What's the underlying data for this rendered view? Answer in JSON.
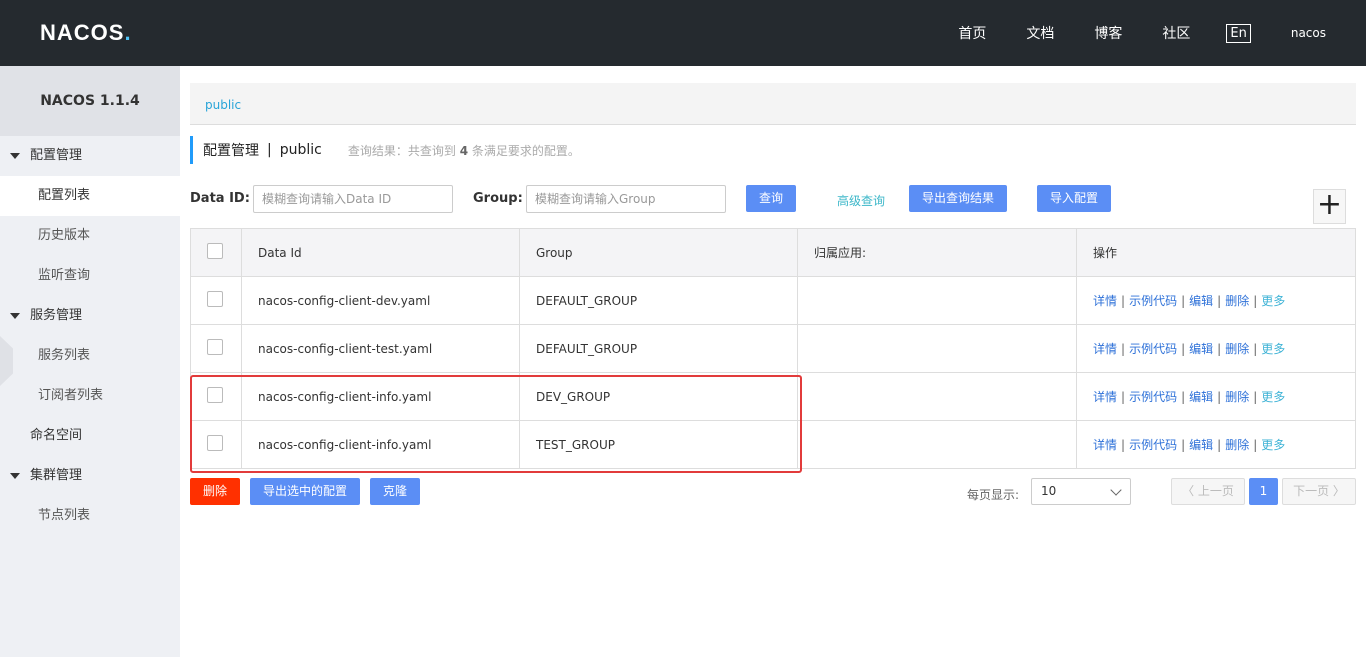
{
  "header": {
    "logo": "NACOS",
    "logo_dot": ".",
    "nav": [
      "首页",
      "文档",
      "博客",
      "社区"
    ],
    "lang": "En",
    "user": "nacos"
  },
  "sidebar": {
    "version": "NACOS 1.1.4",
    "groups": [
      {
        "label": "配置管理",
        "items": [
          "配置列表",
          "历史版本",
          "监听查询"
        ]
      },
      {
        "label": "服务管理",
        "items": [
          "服务列表",
          "订阅者列表"
        ]
      },
      {
        "label": "命名空间"
      },
      {
        "label": "集群管理",
        "items": [
          "节点列表"
        ]
      }
    ]
  },
  "namespace": {
    "current": "public"
  },
  "title": {
    "main": "配置管理",
    "sep": "|",
    "ns": "public",
    "result_prefix": "查询结果：共查询到",
    "result_count": "4",
    "result_suffix": "条满足要求的配置。"
  },
  "search": {
    "dataid_label": "Data ID:",
    "dataid_placeholder": "模糊查询请输入Data ID",
    "group_label": "Group:",
    "group_placeholder": "模糊查询请输入Group",
    "query_btn": "查询",
    "advanced_link": "高级查询",
    "export_btn": "导出查询结果",
    "import_btn": "导入配置",
    "add_btn": "+"
  },
  "table": {
    "headers": [
      "Data Id",
      "Group",
      "归属应用:",
      "操作"
    ],
    "rows": [
      {
        "data_id": "nacos-config-client-dev.yaml",
        "group": "DEFAULT_GROUP",
        "app": ""
      },
      {
        "data_id": "nacos-config-client-test.yaml",
        "group": "DEFAULT_GROUP",
        "app": ""
      },
      {
        "data_id": "nacos-config-client-info.yaml",
        "group": "DEV_GROUP",
        "app": ""
      },
      {
        "data_id": "nacos-config-client-info.yaml",
        "group": "TEST_GROUP",
        "app": ""
      }
    ],
    "ops": {
      "detail": "详情",
      "sample": "示例代码",
      "edit": "编辑",
      "delete": "删除",
      "more": "更多",
      "sep": "|"
    }
  },
  "footer": {
    "delete_btn": "删除",
    "export_selected_btn": "导出选中的配置",
    "clone_btn": "克隆",
    "per_page_label": "每页显示:",
    "per_page_value": "10",
    "prev": "〈 上一页",
    "page": "1",
    "next": "下一页 〉"
  },
  "colors": {
    "primary": "#5b8ef5",
    "danger": "#ff3000",
    "header_bg": "#252a2f",
    "highlight": "#e23b3b"
  }
}
